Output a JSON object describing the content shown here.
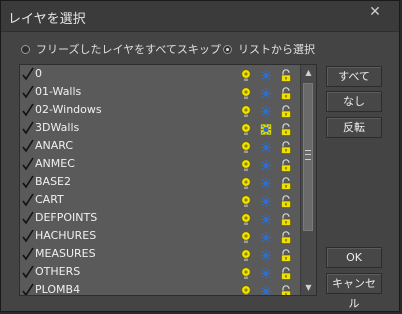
{
  "window": {
    "title": "レイヤを選択",
    "close_glyph": "✕"
  },
  "options": {
    "skip_frozen_label": "フリーズしたレイヤをすべてスキップ",
    "from_list_label": "リストから選択",
    "selected": "from_list"
  },
  "layers": [
    {
      "name": "0",
      "checked": true,
      "sun_icon": "sun-icon"
    },
    {
      "name": "01-Walls",
      "checked": true,
      "sun_icon": "sun-icon"
    },
    {
      "name": "02-Windows",
      "checked": true,
      "sun_icon": "sun-icon"
    },
    {
      "name": "3DWalls",
      "checked": true,
      "sun_icon": "sun-highlighted-icon"
    },
    {
      "name": "ANARC",
      "checked": true,
      "sun_icon": "sun-icon"
    },
    {
      "name": "ANMEC",
      "checked": true,
      "sun_icon": "sun-icon"
    },
    {
      "name": "BASE2",
      "checked": true,
      "sun_icon": "sun-icon"
    },
    {
      "name": "CART",
      "checked": true,
      "sun_icon": "sun-icon"
    },
    {
      "name": "DEFPOINTS",
      "checked": true,
      "sun_icon": "sun-icon"
    },
    {
      "name": "HACHURES",
      "checked": true,
      "sun_icon": "sun-icon"
    },
    {
      "name": "MEASURES",
      "checked": true,
      "sun_icon": "sun-icon"
    },
    {
      "name": "OTHERS",
      "checked": true,
      "sun_icon": "sun-icon"
    },
    {
      "name": "PLOMB4",
      "checked": true,
      "sun_icon": "sun-icon"
    }
  ],
  "buttons": {
    "all": "すべて",
    "none": "なし",
    "invert": "反転",
    "ok": "OK",
    "cancel": "キャンセル"
  },
  "colors": {
    "bulb": "#f2e600",
    "sun": "#2a6fd6",
    "sun_highlight": "#e3d800",
    "lock": "#f0e000",
    "check": "#111111"
  }
}
